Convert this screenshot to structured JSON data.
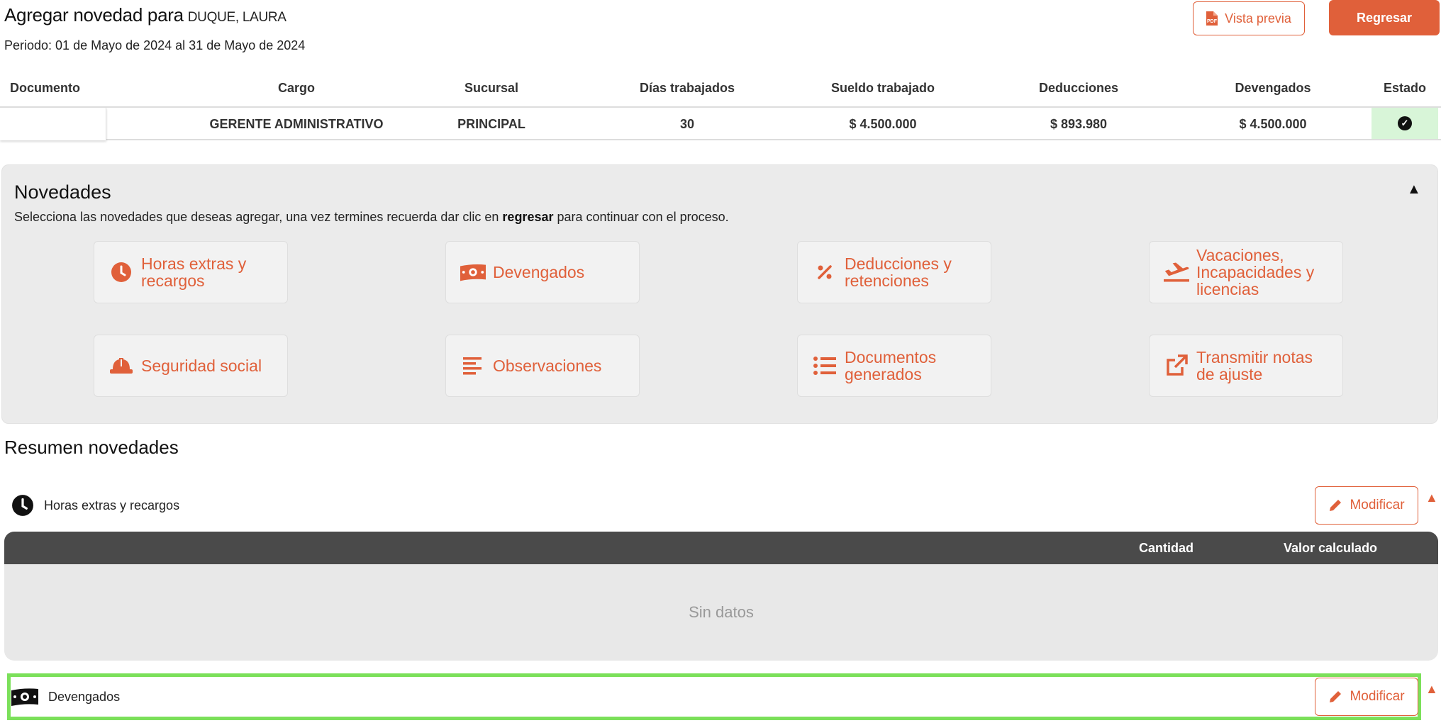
{
  "header": {
    "title_prefix": "Agregar novedad para",
    "employee_name": "DUQUE, LAURA",
    "period": "Periodo: 01 de Mayo de 2024 al 31 de Mayo de 2024",
    "preview_label": "Vista previa",
    "back_label": "Regresar"
  },
  "employee_table": {
    "headers": {
      "documento": "Documento",
      "cargo": "Cargo",
      "sucursal": "Sucursal",
      "dias": "Días trabajados",
      "sueldo": "Sueldo trabajado",
      "deducciones": "Deducciones",
      "devengados": "Devengados",
      "estado": "Estado"
    },
    "row": {
      "documento": "",
      "cargo": "GERENTE ADMINISTRATIVO",
      "sucursal": "PRINCIPAL",
      "dias": "30",
      "sueldo": "$ 4.500.000",
      "deducciones": "$ 893.980",
      "devengados": "$ 4.500.000",
      "estado_icon": "check-circle-icon"
    }
  },
  "novedades": {
    "title": "Novedades",
    "subtitle_before": "Selecciona las novedades que deseas agregar, una vez termines recuerda dar clic en ",
    "subtitle_bold": "regresar",
    "subtitle_after": " para continuar con el proceso.",
    "buttons": [
      {
        "label": "Horas extras y\nrecargos",
        "icon": "clock-icon"
      },
      {
        "label": "Devengados",
        "icon": "money-icon"
      },
      {
        "label": "Deducciones y\nretenciones",
        "icon": "percent-icon"
      },
      {
        "label": "Vacaciones,\nIncapacidades y\nlicencias",
        "icon": "airplane-icon"
      },
      {
        "label": "Seguridad social",
        "icon": "hard-hat-icon"
      },
      {
        "label": "Observaciones",
        "icon": "align-left-icon"
      },
      {
        "label": "Documentos\ngenerados",
        "icon": "list-icon"
      },
      {
        "label": "Transmitir notas\nde ajuste",
        "icon": "external-link-icon"
      }
    ]
  },
  "resumen": {
    "title": "Resumen novedades",
    "sections": [
      {
        "label": "Horas extras y recargos",
        "icon": "clock-icon",
        "modify_label": "Modificar"
      },
      {
        "label": "Devengados",
        "icon": "money-icon",
        "modify_label": "Modificar"
      }
    ],
    "table": {
      "col_cantidad": "Cantidad",
      "col_valor": "Valor calculado",
      "empty_text": "Sin datos"
    }
  },
  "colors": {
    "accent": "#e0603a",
    "panel_bg": "#ebebeb",
    "table_header_bg": "#4a4a4a",
    "status_ok_bg": "#d8f5d8",
    "highlight": "#7be05a"
  }
}
